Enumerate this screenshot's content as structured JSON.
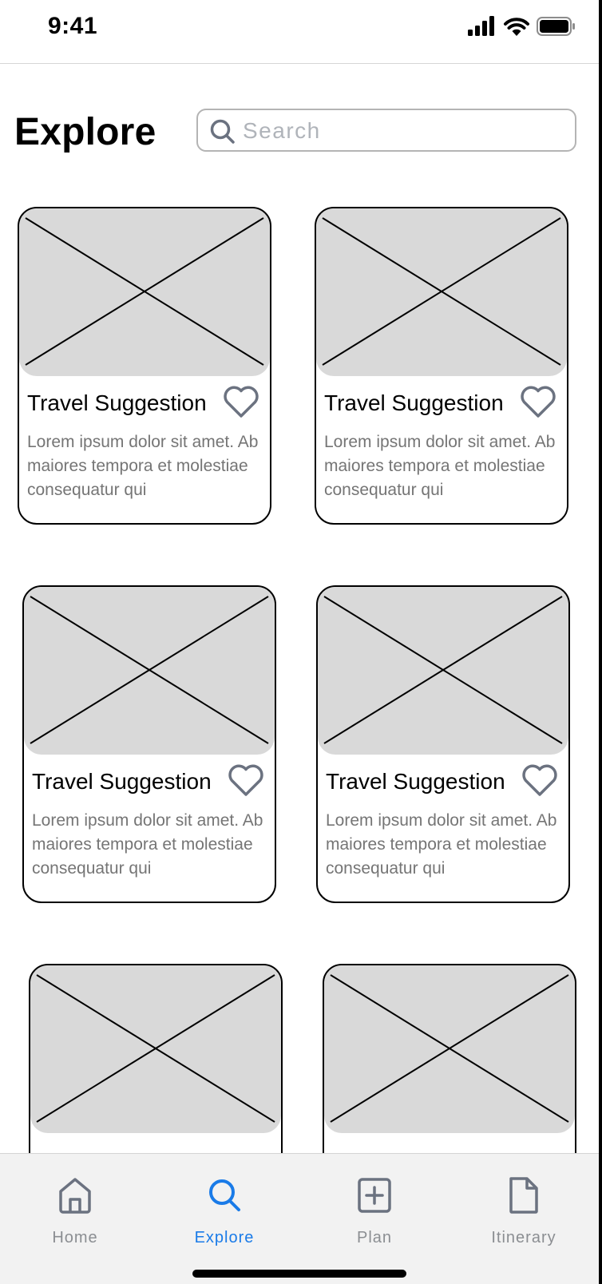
{
  "status_bar": {
    "time": "9:41",
    "icons": [
      "cellular-signal-icon",
      "wifi-icon",
      "battery-icon"
    ]
  },
  "header": {
    "title": "Explore",
    "search": {
      "placeholder": "Search",
      "value": "",
      "icon": "search-icon"
    }
  },
  "cards": [
    {
      "title": "Travel Suggestion",
      "description": "Lorem ipsum dolor sit amet. Ab maiores tempora et molestiae consequatur qui",
      "favorite_icon": "heart-icon",
      "favorited": false
    },
    {
      "title": "Travel Suggestion",
      "description": "Lorem ipsum dolor sit amet. Ab maiores tempora et molestiae consequatur qui",
      "favorite_icon": "heart-icon",
      "favorited": false
    },
    {
      "title": "Travel Suggestion",
      "description": "Lorem ipsum dolor sit amet. Ab maiores tempora et molestiae consequatur qui",
      "favorite_icon": "heart-icon",
      "favorited": false
    },
    {
      "title": "Travel Suggestion",
      "description": "Lorem ipsum dolor sit amet. Ab maiores tempora et molestiae consequatur qui",
      "favorite_icon": "heart-icon",
      "favorited": false
    },
    {
      "title": "",
      "description": "",
      "favorite_icon": "heart-icon",
      "favorited": false
    },
    {
      "title": "",
      "description": "",
      "favorite_icon": "heart-icon",
      "favorited": false
    }
  ],
  "tab_bar": {
    "active": "Explore",
    "accent_color": "#1a7be8",
    "inactive_color": "#8b8e92",
    "tabs": [
      {
        "label": "Home",
        "icon": "home-icon"
      },
      {
        "label": "Explore",
        "icon": "search-icon"
      },
      {
        "label": "Plan",
        "icon": "add-square-icon"
      },
      {
        "label": "Itinerary",
        "icon": "document-icon"
      }
    ]
  }
}
